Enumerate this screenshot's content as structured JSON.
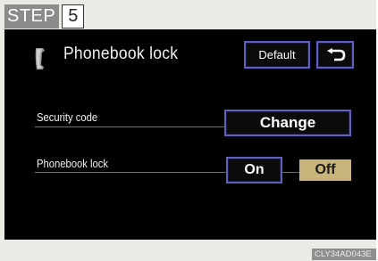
{
  "step": {
    "label": "STEP",
    "number": "5"
  },
  "screen": {
    "title": "Phonebook lock",
    "title_icon": "phone-handset-icon",
    "default_button": "Default",
    "back_icon": "return-arrow-icon"
  },
  "settings": [
    {
      "label": "Security code",
      "control": "Change"
    },
    {
      "label": "Phonebook lock",
      "options": [
        "On",
        "Off"
      ],
      "selected": "Off"
    }
  ],
  "image_code": "CLY34AD043E",
  "colors": {
    "screen_background": "#000000",
    "button_border": "#5d5fc4",
    "selected_option": "#c9b47b",
    "step_badge": "#8b8b8b"
  }
}
